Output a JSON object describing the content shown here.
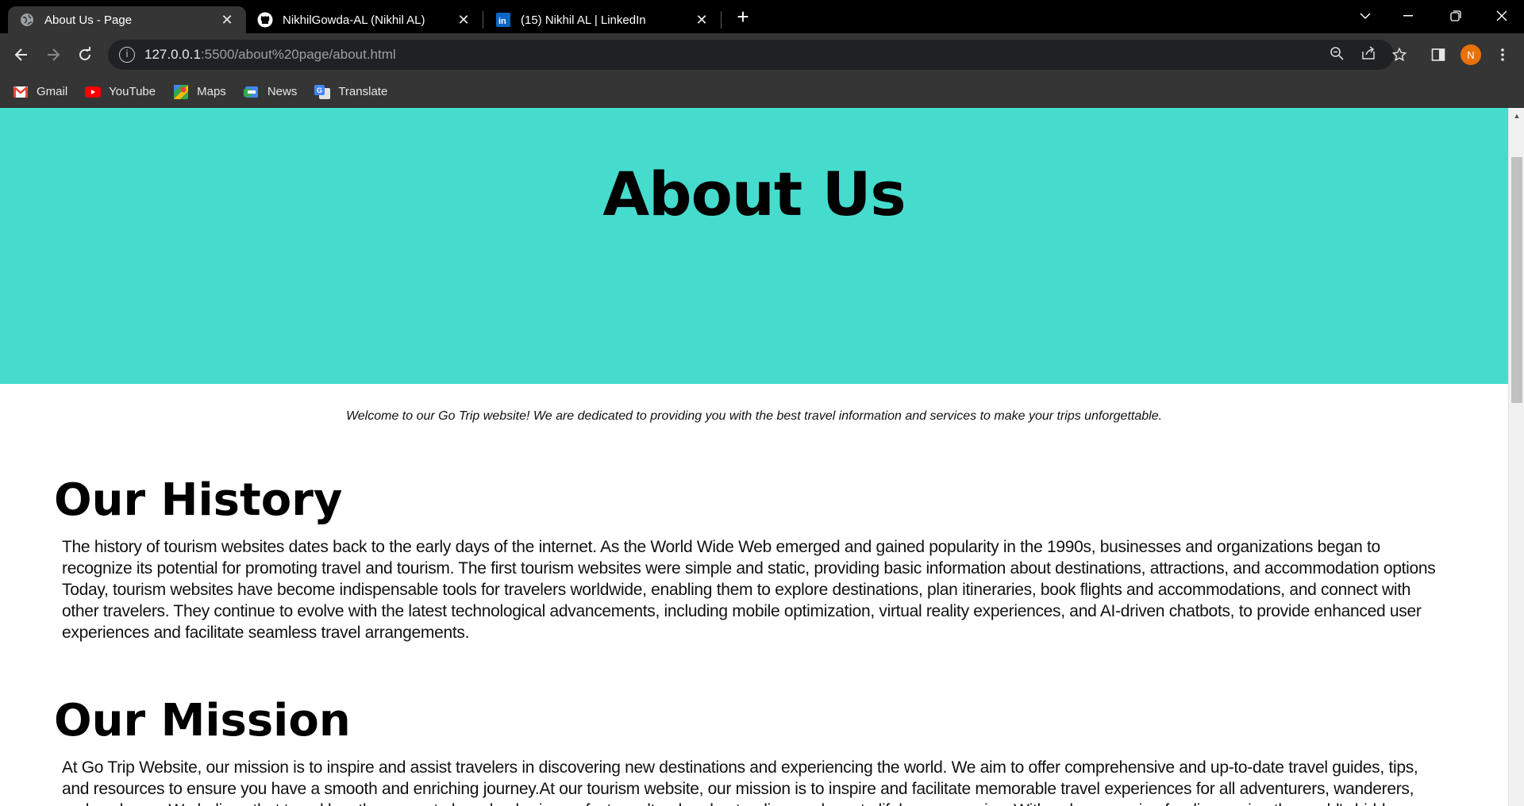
{
  "browser": {
    "tabs": [
      {
        "title": "About Us - Page",
        "icon": "globe-icon",
        "active": true
      },
      {
        "title": "NikhilGowda-AL (Nikhil AL)",
        "icon": "github-icon",
        "active": false
      },
      {
        "title": "(15) Nikhil AL | LinkedIn",
        "icon": "linkedin-icon",
        "active": false
      }
    ],
    "new_tab": "+",
    "address": {
      "host": "127.0.0.1",
      "path": ":5500/about%20page/about.html"
    },
    "profile_initial": "N",
    "bookmarks": [
      {
        "label": "Gmail",
        "icon": "gmail-icon",
        "color": "#ea4335"
      },
      {
        "label": "YouTube",
        "icon": "youtube-icon",
        "color": "#ff0000"
      },
      {
        "label": "Maps",
        "icon": "maps-icon",
        "color": "#34a853"
      },
      {
        "label": "News",
        "icon": "news-icon",
        "color": "#4285f4"
      },
      {
        "label": "Translate",
        "icon": "translate-icon",
        "color": "#4285f4"
      }
    ]
  },
  "page": {
    "hero_title": "About Us",
    "hero_color": "#45dcce",
    "tagline": "Welcome to our Go Trip website! We are dedicated to providing you with the best travel information and services to make your trips unforgettable.",
    "sections": [
      {
        "title": "Our History",
        "body": "The history of tourism websites dates back to the early days of the internet. As the World Wide Web emerged and gained popularity in the 1990s, businesses and organizations began to recognize its potential for promoting travel and tourism. The first tourism websites were simple and static, providing basic information about destinations, attractions, and accommodation options Today, tourism websites have become indispensable tools for travelers worldwide, enabling them to explore destinations, plan itineraries, book flights and accommodations, and connect with other travelers. They continue to evolve with the latest technological advancements, including mobile optimization, virtual reality experiences, and AI-driven chatbots, to provide enhanced user experiences and facilitate seamless travel arrangements."
      },
      {
        "title": "Our Mission",
        "body": "At Go Trip Website, our mission is to inspire and assist travelers in discovering new destinations and experiencing the world. We aim to offer comprehensive and up-to-date travel guides, tips, and resources to ensure you have a smooth and enriching journey.At our tourism website, our mission is to inspire and facilitate memorable travel experiences for all adventurers, wanderers, and explorers. We believe that travel has the power to broaden horizons, foster cultural understanding, and create lifelong memories. With a deep passion for discovering the world's hidden gems, we strive to"
      }
    ]
  }
}
